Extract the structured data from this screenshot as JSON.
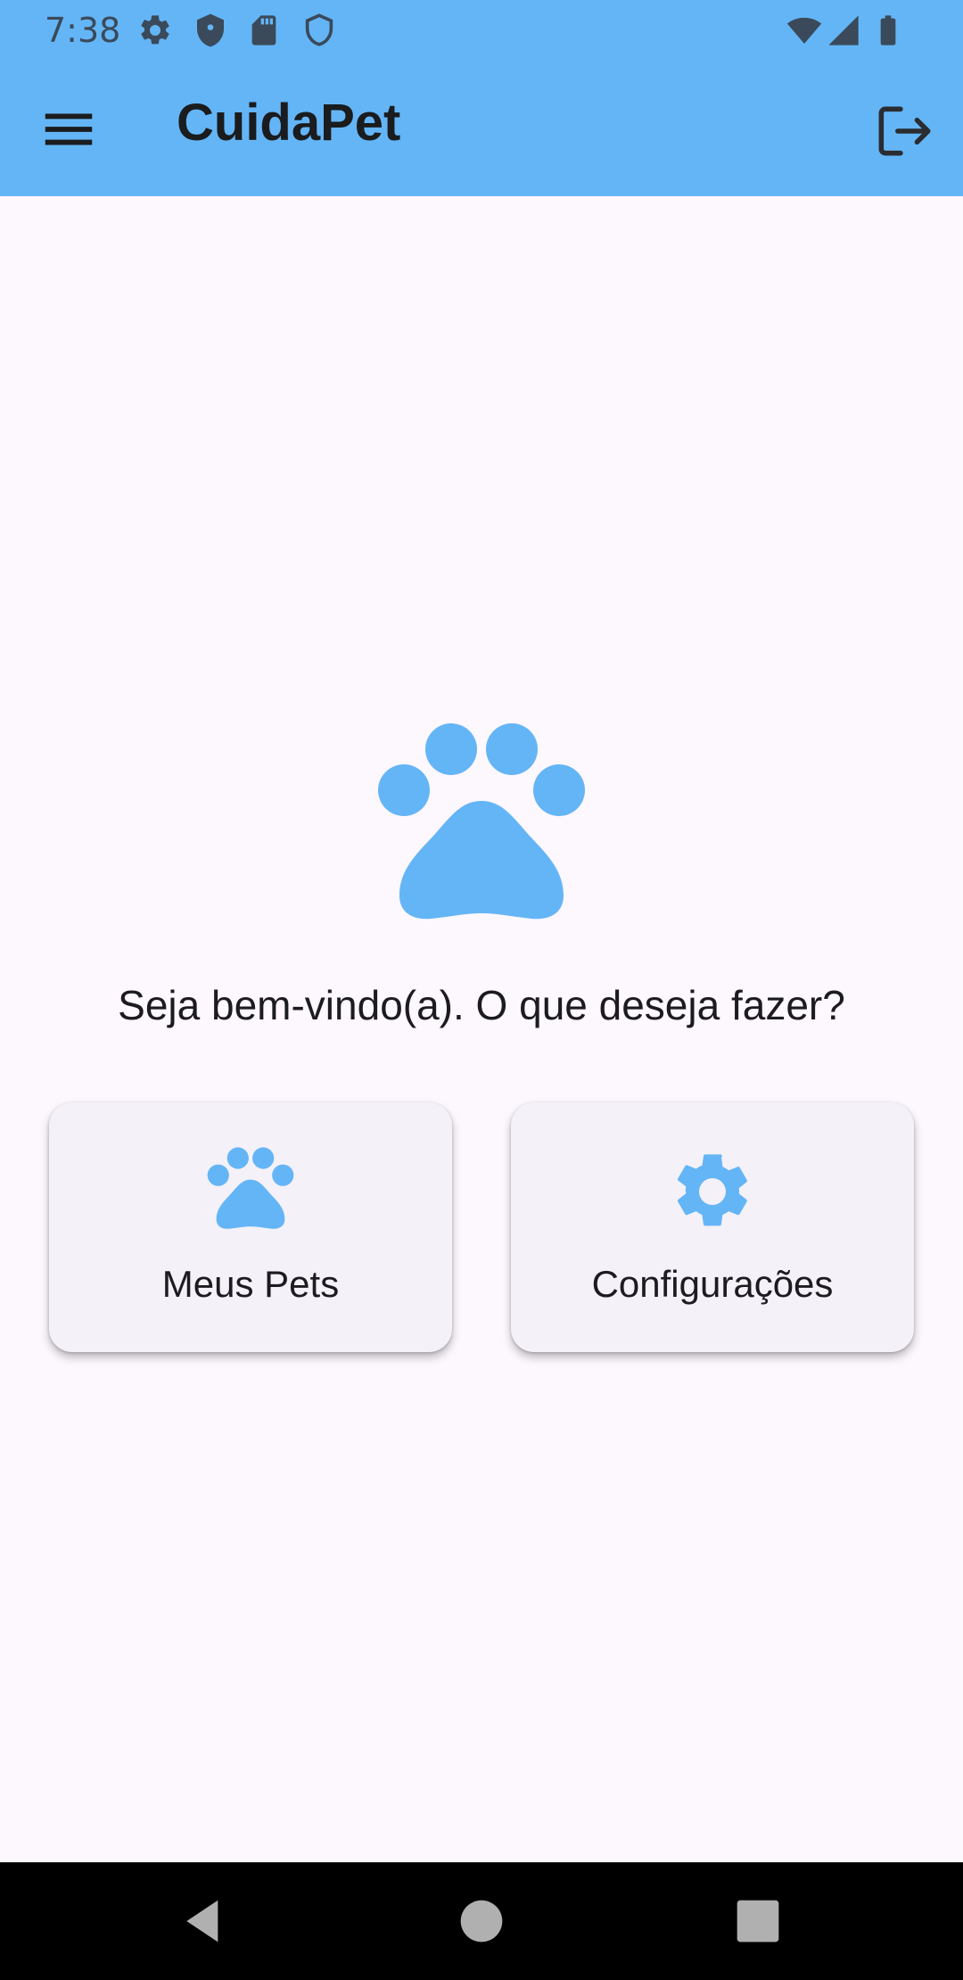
{
  "status_bar": {
    "time": "7:38",
    "left_icons": [
      "settings-icon",
      "shield-icon",
      "sd-card-icon",
      "shield-outline-icon"
    ],
    "right_icons": [
      "wifi-icon",
      "signal-icon",
      "battery-icon"
    ]
  },
  "app_bar": {
    "title": "CuidaPet",
    "menu_icon": "menu-icon",
    "logout_icon": "logout-icon"
  },
  "main": {
    "hero_icon": "paw-icon",
    "welcome_text": "Seja bem-vindo(a). O que deseja fazer?",
    "cards": [
      {
        "label": "Meus Pets",
        "icon": "paw-icon"
      },
      {
        "label": "Configurações",
        "icon": "gear-icon"
      }
    ]
  },
  "nav_bar": {
    "buttons": [
      "back-icon",
      "home-icon",
      "recents-icon"
    ]
  },
  "colors": {
    "app_bar": "#64b5f6",
    "accent_icon": "#64b5f6",
    "background": "#fdf7fe",
    "card": "#f4f1f8"
  }
}
